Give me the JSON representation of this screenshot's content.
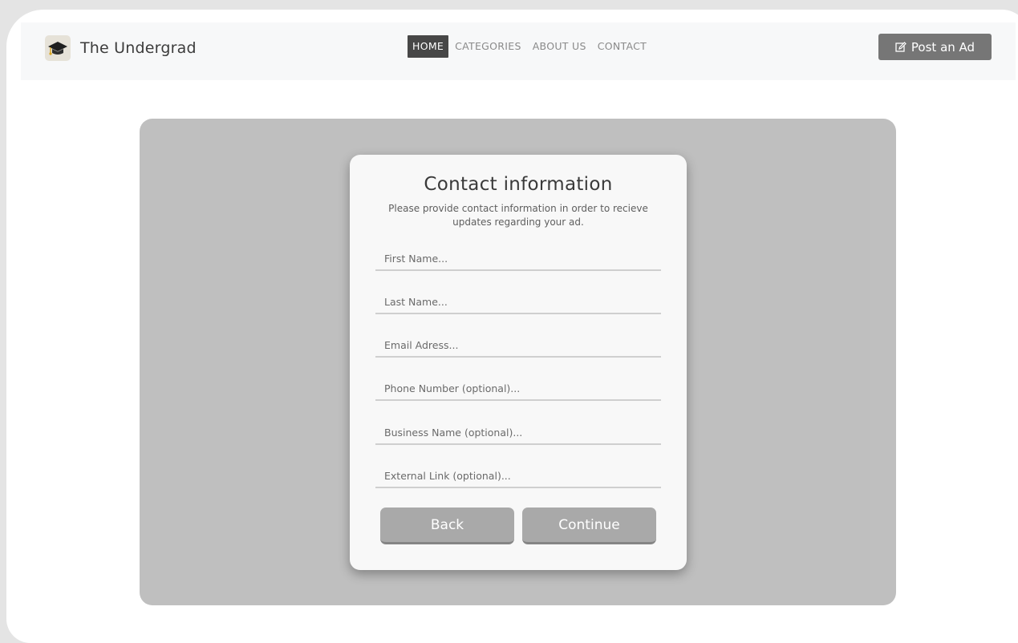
{
  "brand": {
    "name": "The Undergrad",
    "logo_icon": "graduation-cap-icon"
  },
  "nav": {
    "items": [
      {
        "label": "HOME",
        "active": true
      },
      {
        "label": "CATEGORIES",
        "active": false
      },
      {
        "label": "ABOUT US",
        "active": false
      },
      {
        "label": "CONTACT",
        "active": false
      }
    ],
    "post_ad": {
      "label": "Post an Ad",
      "icon": "edit-icon"
    }
  },
  "form": {
    "title": "Contact information",
    "subtitle": "Please provide contact information in order to recieve updates regarding your ad.",
    "fields": [
      {
        "placeholder": "First Name...",
        "value": ""
      },
      {
        "placeholder": "Last Name...",
        "value": ""
      },
      {
        "placeholder": "Email Adress...",
        "value": ""
      },
      {
        "placeholder": "Phone Number (optional)...",
        "value": ""
      },
      {
        "placeholder": "Business Name (optional)...",
        "value": ""
      },
      {
        "placeholder": "External Link (optional)...",
        "value": ""
      }
    ],
    "back_label": "Back",
    "continue_label": "Continue"
  },
  "colors": {
    "nav_active_bg": "#474747",
    "button_bg": "#a9a9a9",
    "panel_bg": "#bfbfbf",
    "post_button_bg": "#767676"
  }
}
